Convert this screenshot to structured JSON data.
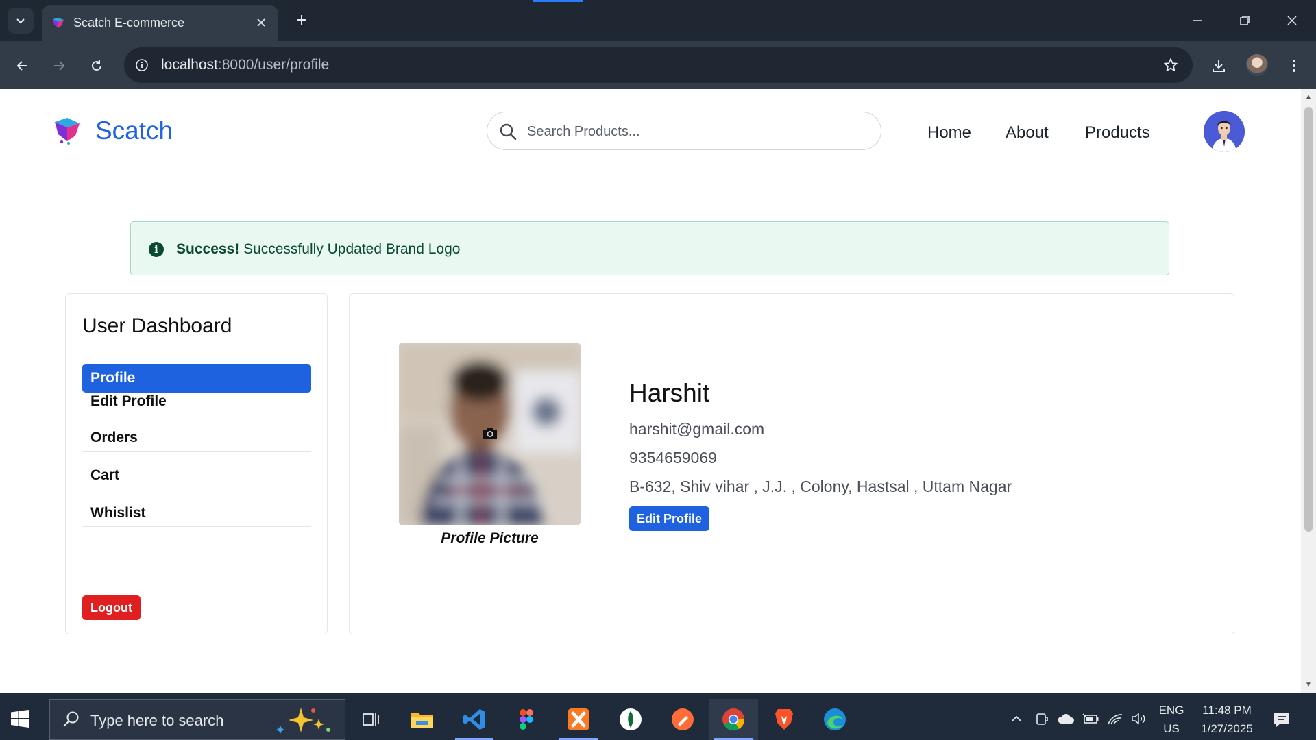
{
  "browser": {
    "tab_title": "Scatch E-commerce",
    "url_host": "localhost",
    "url_rest": ":8000/user/profile"
  },
  "header": {
    "brand": "Scatch",
    "search_placeholder": "Search Products...",
    "nav": [
      "Home",
      "About",
      "Products"
    ]
  },
  "alert": {
    "strong": "Success!",
    "message": " Successfully Updated Brand Logo"
  },
  "sidebar": {
    "title": "User Dashboard",
    "items": [
      "Profile",
      "Edit Profile",
      "Orders",
      "Cart",
      "Whislist"
    ],
    "active_item": "Profile",
    "logout_label": "Logout"
  },
  "profile": {
    "picture_caption": "Profile Picture",
    "name": "Harshit",
    "email": "harshit@gmail.com",
    "phone": "9354659069",
    "address": "B-632, Shiv vihar , J.J. , Colony, Hastsal , Uttam Nagar",
    "edit_button": "Edit Profile"
  },
  "taskbar": {
    "search_placeholder": "Type here to search",
    "lang_line1": "ENG",
    "lang_line2": "US",
    "time": "11:48 PM",
    "date": "1/27/2025"
  },
  "colors": {
    "primary": "#1f62e0",
    "danger": "#e02020",
    "success_bg": "#e9f8f1",
    "success_text": "#0a4a33"
  }
}
